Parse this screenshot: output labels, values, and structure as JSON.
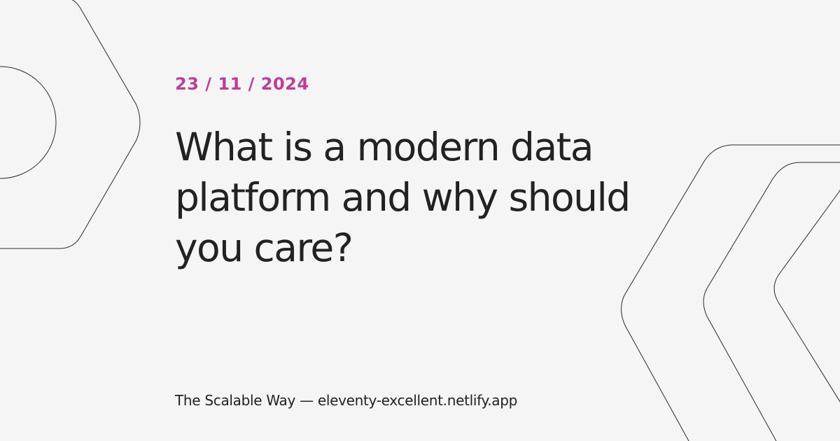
{
  "post": {
    "date": "23 / 11 / 2024",
    "title": "What is a modern data platform and why should you care?"
  },
  "footer": {
    "text": "The Scalable Way — eleventy-excellent.netlify.app"
  },
  "colors": {
    "background": "#f5f5f5",
    "accent": "#c13c98",
    "text": "#222222",
    "line": "#2a2a2a"
  },
  "decorations": {
    "left": "hexagon-outline-shape",
    "right": "chevron-outline-shapes"
  }
}
